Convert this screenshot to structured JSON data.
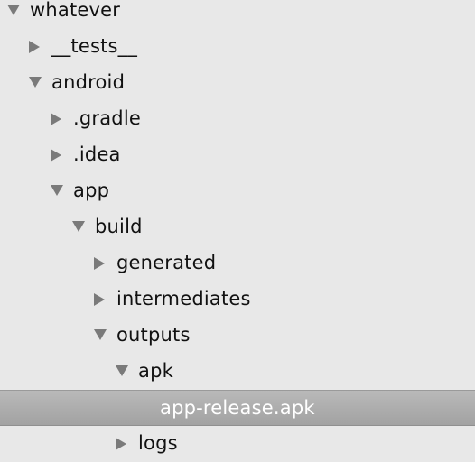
{
  "tree": {
    "items": [
      {
        "label": "whatever",
        "state": "expanded",
        "depth": 0,
        "icon": "disclosure-triangle-expanded-icon"
      },
      {
        "label": "__tests__",
        "state": "collapsed",
        "depth": 1,
        "icon": "disclosure-triangle-collapsed-icon"
      },
      {
        "label": "android",
        "state": "expanded",
        "depth": 1,
        "icon": "disclosure-triangle-expanded-icon"
      },
      {
        "label": ".gradle",
        "state": "collapsed",
        "depth": 2,
        "icon": "disclosure-triangle-collapsed-icon"
      },
      {
        "label": ".idea",
        "state": "collapsed",
        "depth": 2,
        "icon": "disclosure-triangle-collapsed-icon"
      },
      {
        "label": "app",
        "state": "expanded",
        "depth": 2,
        "icon": "disclosure-triangle-expanded-icon"
      },
      {
        "label": "build",
        "state": "expanded",
        "depth": 3,
        "icon": "disclosure-triangle-expanded-icon"
      },
      {
        "label": "generated",
        "state": "collapsed",
        "depth": 4,
        "icon": "disclosure-triangle-collapsed-icon"
      },
      {
        "label": "intermediates",
        "state": "collapsed",
        "depth": 4,
        "icon": "disclosure-triangle-collapsed-icon"
      },
      {
        "label": "outputs",
        "state": "expanded",
        "depth": 4,
        "icon": "disclosure-triangle-expanded-icon"
      },
      {
        "label": "apk",
        "state": "expanded",
        "depth": 5,
        "icon": "disclosure-triangle-expanded-icon"
      },
      {
        "label": "app-release.apk",
        "state": "file",
        "depth": 6,
        "selected": true
      },
      {
        "label": "logs",
        "state": "collapsed",
        "depth": 5,
        "icon": "disclosure-triangle-collapsed-icon"
      }
    ]
  },
  "colors": {
    "background": "#e8e8e8",
    "selection": "#a9a9a9",
    "twisty": "#7a7a7a",
    "selected_text": "#ffffff"
  }
}
